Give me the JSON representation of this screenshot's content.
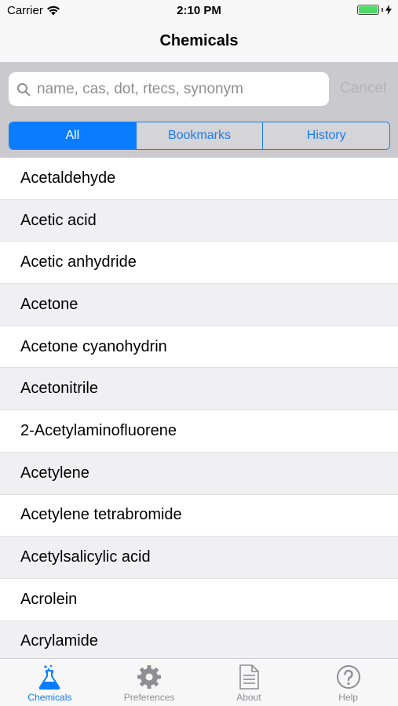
{
  "status_bar": {
    "carrier": "Carrier",
    "time": "2:10 PM",
    "battery_level": 1.0,
    "charging_icon": "bolt-icon",
    "wifi_icon": "wifi-icon"
  },
  "nav": {
    "title": "Chemicals"
  },
  "search": {
    "placeholder": "name, cas, dot, rtecs, synonym",
    "value": "",
    "cancel_label": "Cancel",
    "icon": "search-icon"
  },
  "segments": [
    {
      "label": "All",
      "selected": true
    },
    {
      "label": "Bookmarks",
      "selected": false
    },
    {
      "label": "History",
      "selected": false
    }
  ],
  "chemicals": [
    "Acetaldehyde",
    "Acetic acid",
    "Acetic anhydride",
    "Acetone",
    "Acetone cyanohydrin",
    "Acetonitrile",
    "2-Acetylaminofluorene",
    "Acetylene",
    "Acetylene tetrabromide",
    "Acetylsalicylic acid",
    "Acrolein",
    "Acrylamide"
  ],
  "tabs": [
    {
      "label": "Chemicals",
      "icon": "flask-icon",
      "active": true
    },
    {
      "label": "Preferences",
      "icon": "gear-icon",
      "active": false
    },
    {
      "label": "About",
      "icon": "document-icon",
      "active": false
    },
    {
      "label": "Help",
      "icon": "question-icon",
      "active": false
    }
  ],
  "colors": {
    "accent": "#0a7cff",
    "inactive_tab": "#8e8e93",
    "search_background": "#c9c9ce",
    "row_alt": "#f0f0f2",
    "battery": "#4cd964"
  }
}
